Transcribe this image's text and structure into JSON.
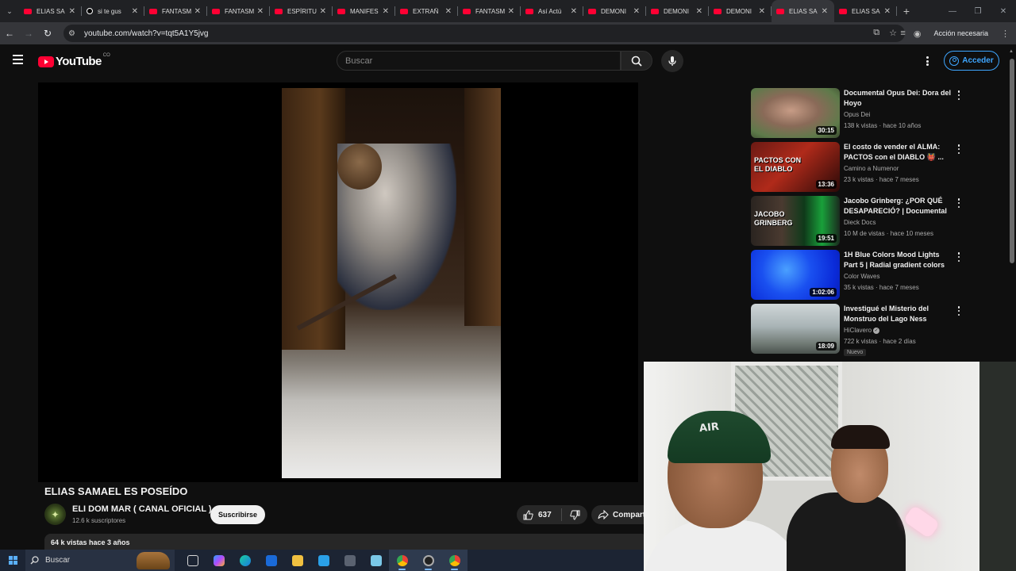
{
  "browser": {
    "tabs": [
      {
        "title": "ELIAS SA",
        "icon": "youtube-icon",
        "active": false
      },
      {
        "title": "si te gus",
        "icon": "tiktok-icon",
        "active": false
      },
      {
        "title": "FANTASM",
        "icon": "youtube-icon",
        "active": false
      },
      {
        "title": "FANTASM",
        "icon": "youtube-icon",
        "active": false
      },
      {
        "title": "ESPÍRITU",
        "icon": "youtube-icon",
        "active": false
      },
      {
        "title": "MANIFES",
        "icon": "youtube-icon",
        "active": false
      },
      {
        "title": "EXTRAÑ",
        "icon": "youtube-icon",
        "active": false
      },
      {
        "title": "FANTASM",
        "icon": "youtube-icon",
        "active": false
      },
      {
        "title": "Así Actú",
        "icon": "youtube-icon",
        "active": false
      },
      {
        "title": "DEMONI",
        "icon": "youtube-icon",
        "active": false
      },
      {
        "title": "DEMONI",
        "icon": "youtube-icon",
        "active": false
      },
      {
        "title": "DEMONI",
        "icon": "youtube-icon",
        "active": false
      },
      {
        "title": "ELIAS SA",
        "icon": "youtube-icon",
        "active": true
      },
      {
        "title": "ELIAS SA",
        "icon": "youtube-icon",
        "active": false
      }
    ],
    "url": "youtube.com/watch?v=tqt5A1Y5jvg",
    "action_required": "Acción necesaria"
  },
  "youtube": {
    "logo_text": "YouTube",
    "country_code": "CO",
    "search_placeholder": "Buscar",
    "sign_in": "Acceder"
  },
  "video": {
    "title": "ELIAS SAMAEL ES POSEÍDO",
    "channel": "ELI DOM MAR ( CANAL OFICIAL )",
    "subscribers": "12.6 k suscriptores",
    "subscribe": "Suscribirse",
    "likes": "637",
    "share": "Compartir",
    "views_date": "64 k vistas  hace 3 años"
  },
  "recommendations": [
    {
      "title": "Documental Opus Dei: Dora del Hoyo",
      "channel": "Opus Dei",
      "meta": "138 k vistas · hace 10 años",
      "duration": "30:15",
      "verified": false,
      "badge": ""
    },
    {
      "title": "El costo de vender el ALMA: PACTOS con el DIABLO 👹 ...",
      "channel": "Camino a Numenor",
      "meta": "23 k vistas · hace 7 meses",
      "duration": "13:36",
      "verified": false,
      "badge": "",
      "thumb_text": "PACTOS CON EL DIABLO"
    },
    {
      "title": "Jacobo Grinberg: ¿POR QUÉ DESAPARECIÓ? | Documental",
      "channel": "Dieck Docs",
      "meta": "10 M de vistas · hace 10 meses",
      "duration": "19:51",
      "verified": false,
      "badge": "",
      "thumb_text": "JACOBO GRINBERG"
    },
    {
      "title": "1H  Blue  Colors Mood Lights Part 5 | Radial gradient colors |...",
      "channel": "Color Waves",
      "meta": "35 k vistas · hace 7 meses",
      "duration": "1:02:06",
      "verified": false,
      "badge": ""
    },
    {
      "title": "Investigué el Misterio del Monstruo del Lago Ness",
      "channel": "HiClavero",
      "meta": "722 k vistas · hace 2 días",
      "duration": "18:09",
      "verified": true,
      "badge": "Nuevo"
    }
  ],
  "taskbar": {
    "search_label": "Buscar",
    "apps": [
      "task-view-icon",
      "copilot-icon",
      "edge-icon",
      "outlook-icon",
      "file-explorer-icon",
      "store-icon",
      "calculator-icon",
      "notepad-icon",
      "chrome-icon",
      "obs-icon",
      "chrome-icon"
    ]
  },
  "colors": {
    "yt_red": "#ff0033",
    "link_blue": "#3ea6ff",
    "bg": "#0f0f0f"
  }
}
